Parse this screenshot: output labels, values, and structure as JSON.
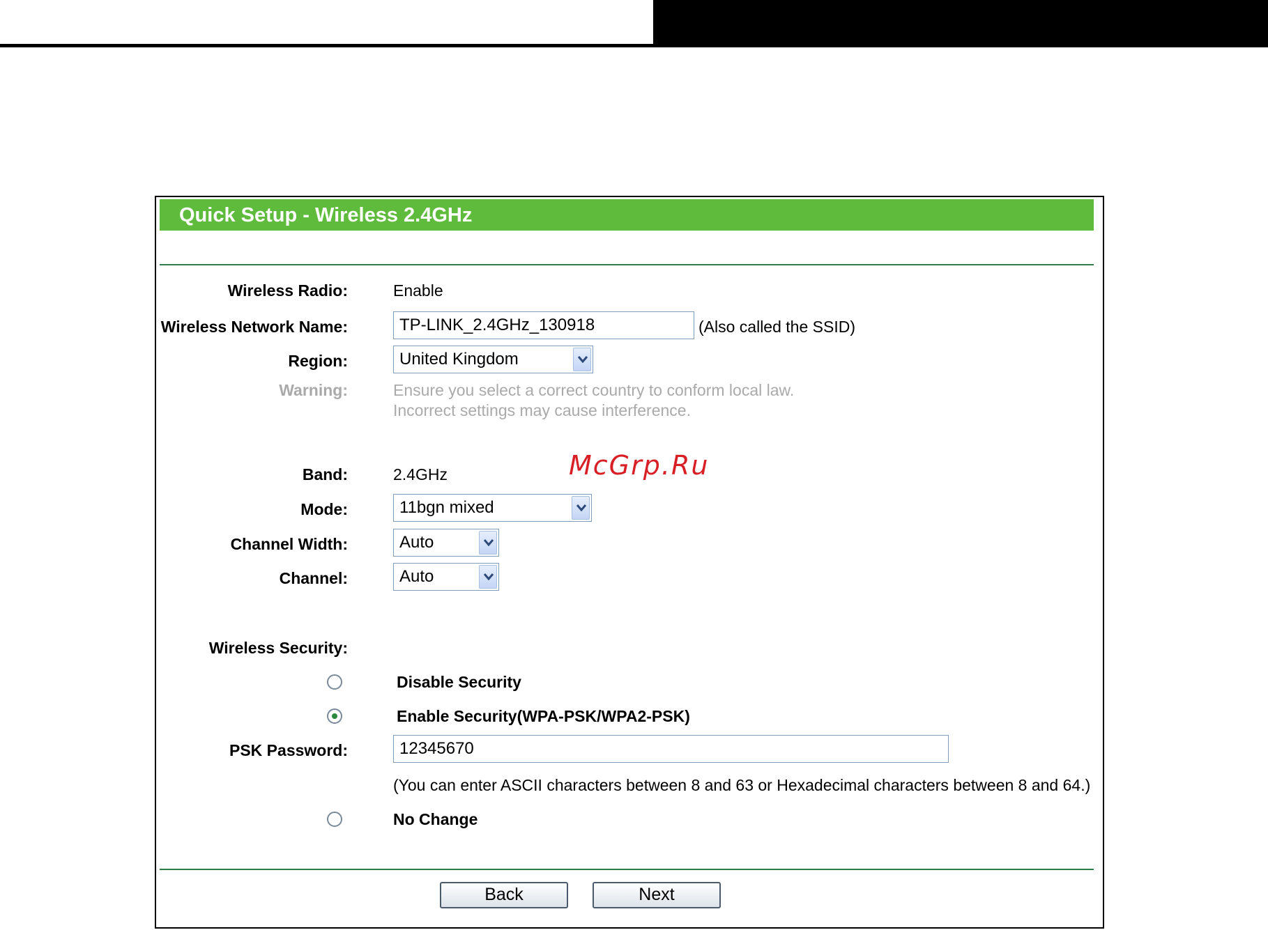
{
  "header": {
    "title": "Quick Setup - Wireless 2.4GHz"
  },
  "fields": {
    "wireless_radio": {
      "label": "Wireless Radio:",
      "value": "Enable"
    },
    "network_name": {
      "label": "Wireless Network Name:",
      "value": "TP-LINK_2.4GHz_130918",
      "hint": "(Also called the SSID)"
    },
    "region": {
      "label": "Region:",
      "value": "United Kingdom"
    },
    "warning": {
      "label": "Warning:",
      "line1": "Ensure you select a correct country to conform local law.",
      "line2": "Incorrect settings may cause interference."
    },
    "band": {
      "label": "Band:",
      "value": "2.4GHz"
    },
    "mode": {
      "label": "Mode:",
      "value": "11bgn mixed"
    },
    "channel_width": {
      "label": "Channel Width:",
      "value": "Auto"
    },
    "channel": {
      "label": "Channel:",
      "value": "Auto"
    }
  },
  "security": {
    "label": "Wireless Security:",
    "options": [
      {
        "label": "Disable Security",
        "selected": false
      },
      {
        "label": "Enable Security(WPA-PSK/WPA2-PSK)",
        "selected": true
      },
      {
        "label": "No Change",
        "selected": false
      }
    ],
    "psk_label": "PSK Password:",
    "psk_value": "12345670",
    "psk_hint": "(You can enter ASCII characters between 8 and 63 or Hexadecimal characters between 8 and 64.)"
  },
  "buttons": {
    "back": "Back",
    "next": "Next"
  },
  "watermark": "McGrp.Ru",
  "colors": {
    "header_bg": "#5fbb3b",
    "divider": "#2e7d4a",
    "warning_text": "#aaaaaa",
    "watermark": "#d81f26"
  }
}
